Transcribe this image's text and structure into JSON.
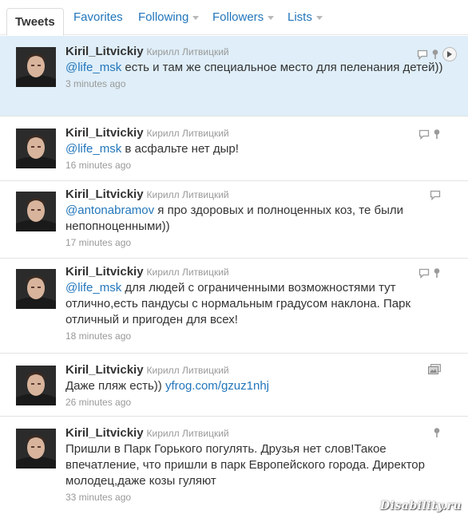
{
  "tabs": [
    {
      "label": "Tweets",
      "active": true,
      "dropdown": false
    },
    {
      "label": "Favorites",
      "active": false,
      "dropdown": false
    },
    {
      "label": "Following",
      "active": false,
      "dropdown": true
    },
    {
      "label": "Followers",
      "active": false,
      "dropdown": true
    },
    {
      "label": "Lists",
      "active": false,
      "dropdown": true
    }
  ],
  "tweets": [
    {
      "username": "Kiril_Litvickiy",
      "fullname": "Кирилл Литвицкий",
      "mention": "@life_msk",
      "text": " есть и там же специальное место для пеленания детей))",
      "time": "3 minutes ago",
      "highlighted": true,
      "icons": [
        "reply-icon",
        "location-icon",
        "expand-icon"
      ]
    },
    {
      "username": "Kiril_Litvickiy",
      "fullname": "Кирилл Литвицкий",
      "mention": "@life_msk",
      "text": " в асфальте нет дыр!",
      "time": "16 minutes ago",
      "highlighted": false,
      "icons": [
        "reply-icon",
        "location-icon"
      ]
    },
    {
      "username": "Kiril_Litvickiy",
      "fullname": "Кирилл Литвицкий",
      "mention": "@antonabramov",
      "text": " я про здоровых и полноценных коз, те были непопноценными))",
      "time": "17 minutes ago",
      "highlighted": false,
      "icons": [
        "reply-icon"
      ]
    },
    {
      "username": "Kiril_Litvickiy",
      "fullname": "Кирилл Литвицкий",
      "mention": "@life_msk",
      "text": " для людей с ограниченными возможностями тут отлично,есть пандусы с нормальным градусом наклона. Парк отличный и пригоден для всех!",
      "time": "18 minutes ago",
      "highlighted": false,
      "icons": [
        "reply-icon",
        "location-icon"
      ]
    },
    {
      "username": "Kiril_Litvickiy",
      "fullname": "Кирилл Литвицкий",
      "text": "Даже пляж есть)) ",
      "link": "yfrog.com/gzuz1nhj",
      "time": "26 minutes ago",
      "highlighted": false,
      "icons": [
        "photo-icon"
      ]
    },
    {
      "username": "Kiril_Litvickiy",
      "fullname": "Кирилл Литвицкий",
      "text": "Пришли в Парк Горького погулять. Друзья нет слов!Такое впечатление, что пришли в парк Европейского города. Директор молодец,даже козы гуляют",
      "time": "33 minutes ago",
      "highlighted": false,
      "icons": [
        "location-icon"
      ]
    }
  ],
  "watermark": "Disability.ru",
  "colors": {
    "link": "#2276bb",
    "highlight": "#dfeef8",
    "meta": "#999999",
    "text": "#333333"
  }
}
